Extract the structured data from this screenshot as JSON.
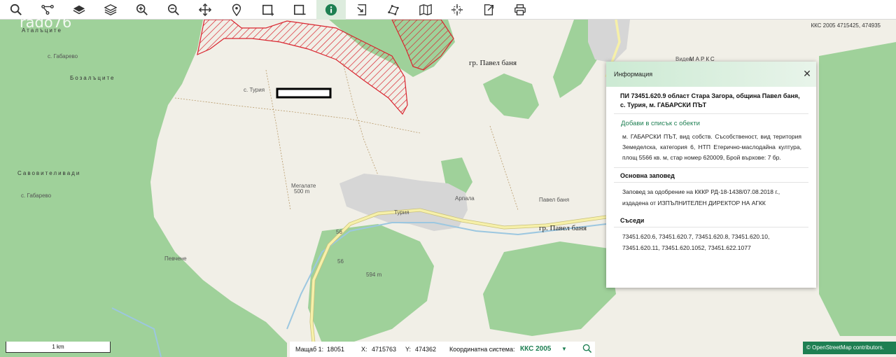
{
  "toolbar": {
    "tools": [
      {
        "name": "search-tool",
        "icon": "search-icon"
      },
      {
        "name": "network-tool",
        "icon": "network-icon"
      },
      {
        "name": "basemap-tool",
        "icon": "layers-filled-icon"
      },
      {
        "name": "layers-tool",
        "icon": "layers-icon"
      },
      {
        "name": "zoom-in-tool",
        "icon": "zoom-in-icon"
      },
      {
        "name": "zoom-out-tool",
        "icon": "zoom-out-icon"
      },
      {
        "name": "pan-tool",
        "icon": "move-icon"
      },
      {
        "name": "locate-tool",
        "icon": "map-pin-icon"
      },
      {
        "name": "select-area-tool",
        "icon": "rectangle-select-icon"
      },
      {
        "name": "deselect-area-tool",
        "icon": "rectangle-deselect-icon"
      },
      {
        "name": "info-tool",
        "icon": "info-icon",
        "active": true
      },
      {
        "name": "import-tool",
        "icon": "import-icon"
      },
      {
        "name": "draw-tool",
        "icon": "polygon-icon"
      },
      {
        "name": "map-tool",
        "icon": "folded-map-icon"
      },
      {
        "name": "measure-tool",
        "icon": "crosshair-icon"
      },
      {
        "name": "export-tool",
        "icon": "export-icon"
      },
      {
        "name": "print-tool",
        "icon": "printer-icon"
      }
    ],
    "active_color": "#ddecde"
  },
  "watermark": "rado76",
  "map": {
    "coord_readout": "ККС 2005 4715425, 474935",
    "labels": {
      "atalcite": "Аталъците",
      "gabarevo_top": "с. Габарево",
      "bozalcite": "Бозалъците",
      "turia_small": "с. Турия",
      "savovitelivadi": "Савовителивади",
      "gabarevo_left": "с. Габарево",
      "pavel_banya_top": "гр. Павел баня",
      "pavel_banya_bottom": "гр. Павел баня",
      "marks": "МАРКС",
      "viden": "Виден",
      "turia_village": "Турия",
      "arpala": "Арпала",
      "megalate": "Мегалате",
      "megalate_elev": "500 m",
      "peak_elev": "594 m",
      "pevchene": "Певчене",
      "road_56_a": "56",
      "road_56_b": "56",
      "pavel_banya_road": "Павел баня"
    },
    "colors": {
      "forest": "#9fd19a",
      "open_land": "#f1efe7",
      "settlement": "#d6d6d6",
      "road": "#f6f0a9",
      "river": "#9cc7e0",
      "parcel_hatch": "#d9252f"
    }
  },
  "info_panel": {
    "title": "Информация",
    "parcel_heading": "ПИ 73451.620.9 област Стара Загора, община Павел баня, с. Турия, м. ГАБАРСКИ ПЪТ",
    "add_to_list": "Добави в списък с обекти",
    "description": "м. ГАБАРСКИ ПЪТ, вид собств. Съсобственост, вид територия Земеделска, категория 6, НТП Етерично-маслодайна култура, площ 5566 кв. м, стар номер 620009, Брой върхове: 7 бр.",
    "order_title": "Основна заповед",
    "order_text": "Заповед за одобрение на КККР РД-18-1438/07.08.2018 г., издадена от ИЗПЪЛНИТЕЛЕН ДИРЕКТОР НА АГКК",
    "neighbors_title": "Съседи",
    "neighbors_text": "73451.620.6, 73451.620.7, 73451.620.8, 73451.620.10, 73451.620.11, 73451.620.1052, 73451.622.1077"
  },
  "status": {
    "scale_bar_label": "1 km",
    "scale_label": "Мащаб 1:",
    "scale_value": "18051",
    "x_label": "X:",
    "x_value": "4715763",
    "y_label": "Y:",
    "y_value": "474362",
    "coord_system_label": "Координатна система:",
    "coord_system_value": "ККС 2005",
    "attribution": "© OpenStreetMap contributors."
  }
}
